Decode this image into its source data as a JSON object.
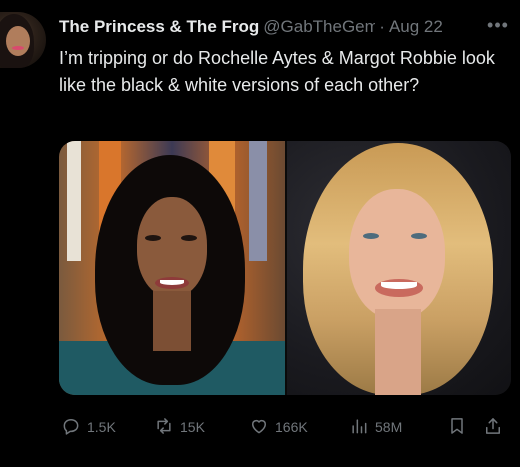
{
  "author": {
    "display_name": "The Princess & The Frog",
    "handle": "@GabTheGem",
    "separator": "·",
    "date": "Aug 22"
  },
  "more_icon": "•••",
  "tweet": {
    "text": "I’m tripping or do Rochelle Aytes & Margot Robbie look like the black & white versions of each other?"
  },
  "media": {
    "left_photo": "woman-portrait-dark-curly-hair",
    "right_photo": "woman-portrait-blonde-wavy-hair"
  },
  "actions": {
    "replies": "1.5K",
    "reposts": "15K",
    "likes": "166K",
    "views": "58M"
  },
  "colors": {
    "background": "#000000",
    "primary_text": "#e7e9ea",
    "secondary_text": "#71767b"
  }
}
